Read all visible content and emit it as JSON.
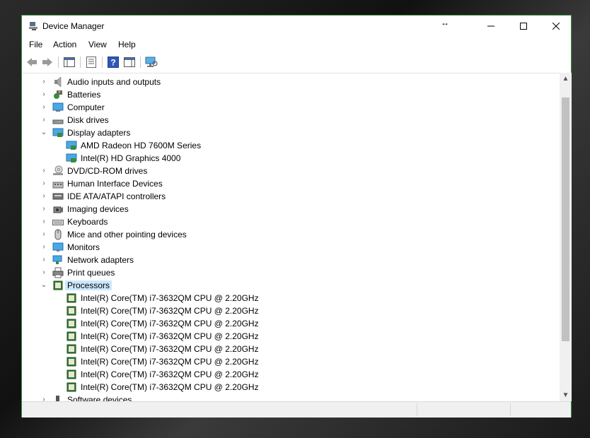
{
  "window": {
    "title": "Device Manager",
    "resize_cursor": "↔"
  },
  "menu": [
    "File",
    "Action",
    "View",
    "Help"
  ],
  "toolbar": {
    "buttons": [
      "back-icon",
      "forward-icon",
      "show-hide-console-tree-icon",
      "properties-icon",
      "help-icon",
      "action-pane-icon",
      "scan-hardware-icon"
    ]
  },
  "tree": {
    "categories": [
      {
        "label": "Audio inputs and outputs",
        "icon": "speaker-icon",
        "expanded": false
      },
      {
        "label": "Batteries",
        "icon": "battery-icon",
        "expanded": false
      },
      {
        "label": "Computer",
        "icon": "computer-icon",
        "expanded": false
      },
      {
        "label": "Disk drives",
        "icon": "disk-drive-icon",
        "expanded": false
      },
      {
        "label": "Display adapters",
        "icon": "display-adapter-icon",
        "expanded": true
      },
      {
        "label": "DVD/CD-ROM drives",
        "icon": "dvd-drive-icon",
        "expanded": false
      },
      {
        "label": "Human Interface Devices",
        "icon": "hid-icon",
        "expanded": false
      },
      {
        "label": "IDE ATA/ATAPI controllers",
        "icon": "ide-controller-icon",
        "expanded": false
      },
      {
        "label": "Imaging devices",
        "icon": "camera-icon",
        "expanded": false
      },
      {
        "label": "Keyboards",
        "icon": "keyboard-icon",
        "expanded": false
      },
      {
        "label": "Mice and other pointing devices",
        "icon": "mouse-icon",
        "expanded": false
      },
      {
        "label": "Monitors",
        "icon": "monitor-icon",
        "expanded": false
      },
      {
        "label": "Network adapters",
        "icon": "network-adapter-icon",
        "expanded": false
      },
      {
        "label": "Print queues",
        "icon": "printer-icon",
        "expanded": false
      },
      {
        "label": "Processors",
        "icon": "processor-icon",
        "expanded": true,
        "selected": true
      },
      {
        "label": "Software devices",
        "icon": "software-device-icon",
        "expanded": false
      }
    ],
    "display_adapters": [
      "AMD Radeon HD 7600M Series",
      "Intel(R) HD Graphics 4000"
    ],
    "processors": [
      "Intel(R) Core(TM) i7-3632QM CPU @ 2.20GHz",
      "Intel(R) Core(TM) i7-3632QM CPU @ 2.20GHz",
      "Intel(R) Core(TM) i7-3632QM CPU @ 2.20GHz",
      "Intel(R) Core(TM) i7-3632QM CPU @ 2.20GHz",
      "Intel(R) Core(TM) i7-3632QM CPU @ 2.20GHz",
      "Intel(R) Core(TM) i7-3632QM CPU @ 2.20GHz",
      "Intel(R) Core(TM) i7-3632QM CPU @ 2.20GHz",
      "Intel(R) Core(TM) i7-3632QM CPU @ 2.20GHz"
    ]
  },
  "colors": {
    "selection": "#cce8ff",
    "window_border": "#3c8f3c"
  }
}
